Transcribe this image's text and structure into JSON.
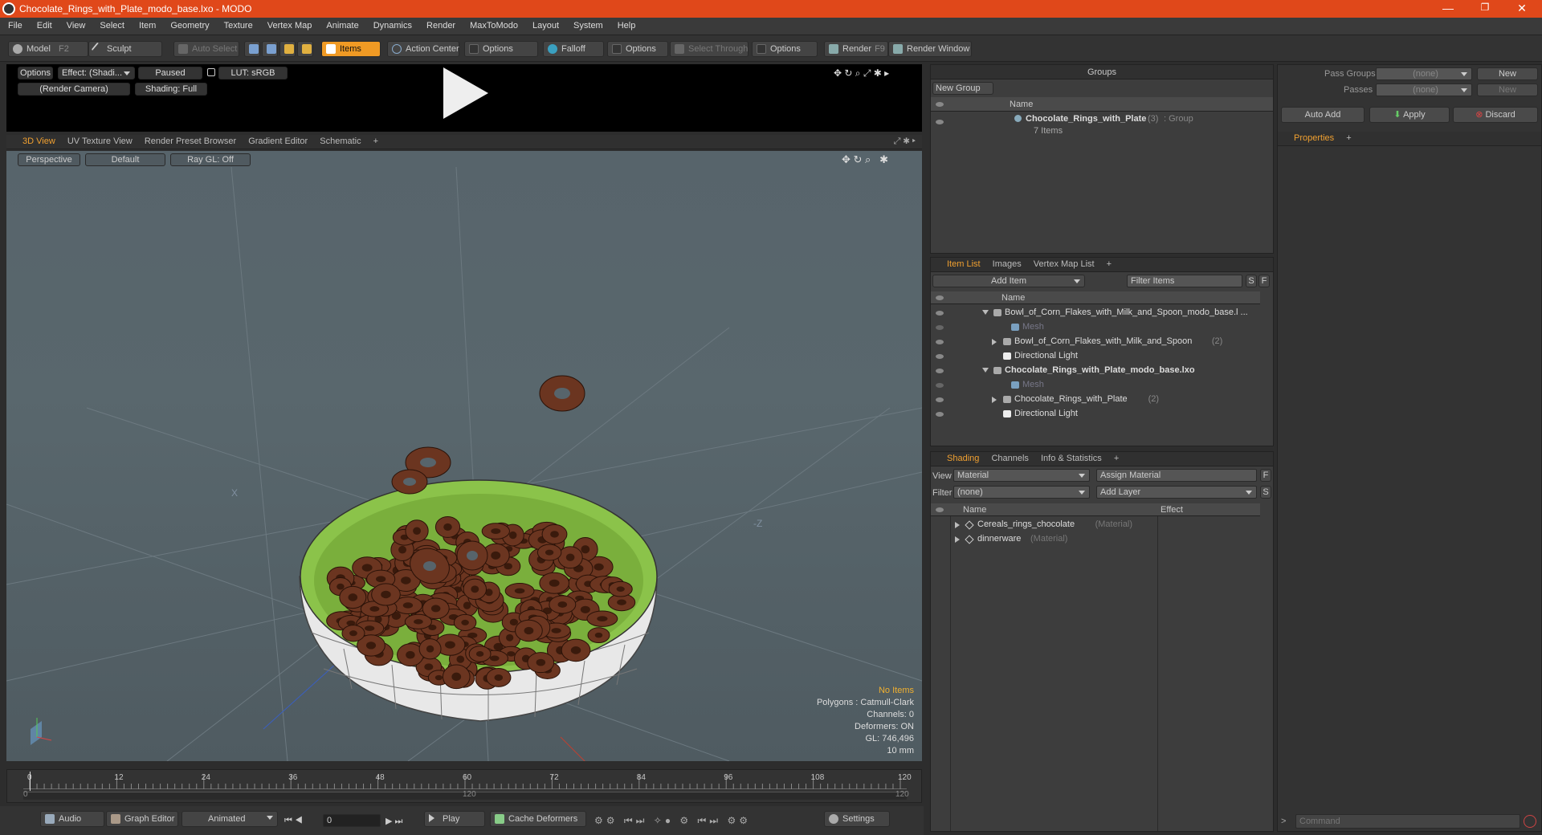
{
  "window": {
    "title": "Chocolate_Rings_with_Plate_modo_base.lxo - MODO",
    "minimize": "—",
    "maximize": "❐",
    "close": "✕"
  },
  "menu": [
    "File",
    "Edit",
    "View",
    "Select",
    "Item",
    "Geometry",
    "Texture",
    "Vertex Map",
    "Animate",
    "Dynamics",
    "Render",
    "MaxToModo",
    "Layout",
    "System",
    "Help"
  ],
  "toolbar": {
    "model": "Model",
    "model_key": "F2",
    "sculpt": "Sculpt",
    "auto_select": "Auto Select",
    "items": "Items",
    "action_center": "Action Center",
    "options1": "Options",
    "falloff": "Falloff",
    "options2": "Options",
    "select_through": "Select Through",
    "options3": "Options",
    "render": "Render",
    "render_key": "F9",
    "render_window": "Render Window"
  },
  "preview": {
    "options": "Options",
    "effect": "Effect: (Shadi...",
    "paused": "Paused",
    "lut": "LUT: sRGB",
    "camera": "(Render Camera)",
    "shading": "Shading: Full"
  },
  "viewport_tabs": [
    "3D View",
    "UV Texture View",
    "Render Preset Browser",
    "Gradient Editor",
    "Schematic",
    "+"
  ],
  "viewport_bar": {
    "perspective": "Perspective",
    "default": "Default",
    "raygl": "Ray GL: Off"
  },
  "viewport_stats": {
    "no_items": "No Items",
    "polygons": "Polygons : Catmull-Clark",
    "channels": "Channels: 0",
    "deformers": "Deformers: ON",
    "gl": "GL: 746,496",
    "size": "10 mm"
  },
  "timeline": {
    "ticks": [
      "0",
      "12",
      "24",
      "36",
      "48",
      "60",
      "72",
      "84",
      "96",
      "108",
      "120"
    ],
    "low": "0",
    "mid": "120",
    "high": "120"
  },
  "bottombar": {
    "audio": "Audio",
    "graph_editor": "Graph Editor",
    "animated": "Animated",
    "frame": "0",
    "play": "Play",
    "cache": "Cache Deformers",
    "settings": "Settings"
  },
  "groups": {
    "title": "Groups",
    "new_group": "New Group",
    "name_col": "Name",
    "item_name": "Chocolate_Rings_with_Plate",
    "item_count": "(3)",
    "item_type": ": Group",
    "item_sub": "7 Items"
  },
  "pass": {
    "pass_groups": "Pass Groups",
    "passes": "Passes",
    "none1": "(none)",
    "none2": "(none)",
    "new1": "New",
    "new2": "New",
    "auto_add": "Auto Add",
    "apply": "Apply",
    "discard": "Discard",
    "properties": "Properties",
    "plus": "+"
  },
  "itemlist": {
    "tabs": [
      "Item List",
      "Images",
      "Vertex Map List",
      "+"
    ],
    "add_item": "Add Item",
    "filter": "Filter Items",
    "s": "S",
    "f": "F",
    "name_col": "Name",
    "rows": [
      {
        "text": "Bowl_of_Corn_Flakes_with_Milk_and_Spoon_modo_base.l ...",
        "extra": "",
        "indent": 0,
        "bold": false,
        "kind": "scene"
      },
      {
        "text": "Mesh",
        "extra": "",
        "indent": 2,
        "bold": false,
        "kind": "mesh"
      },
      {
        "text": "Bowl_of_Corn_Flakes_with_Milk_and_Spoon",
        "extra": "(2)",
        "indent": 1,
        "bold": false,
        "kind": "group"
      },
      {
        "text": "Directional Light",
        "extra": "",
        "indent": 1,
        "bold": false,
        "kind": "light"
      },
      {
        "text": "Chocolate_Rings_with_Plate_modo_base.lxo",
        "extra": "",
        "indent": 0,
        "bold": true,
        "kind": "scene"
      },
      {
        "text": "Mesh",
        "extra": "",
        "indent": 2,
        "bold": false,
        "kind": "mesh"
      },
      {
        "text": "Chocolate_Rings_with_Plate",
        "extra": "(2)",
        "indent": 1,
        "bold": false,
        "kind": "group"
      },
      {
        "text": "Directional Light",
        "extra": "",
        "indent": 1,
        "bold": false,
        "kind": "light"
      }
    ]
  },
  "shading": {
    "tabs": [
      "Shading",
      "Channels",
      "Info & Statistics",
      "+"
    ],
    "view": "View",
    "material": "Material",
    "assign": "Assign Material",
    "f": "F",
    "filter": "Filter",
    "none": "(none)",
    "add_layer": "Add Layer",
    "s": "S",
    "name_col": "Name",
    "effect_col": "Effect",
    "rows": [
      {
        "name": "Cereals_rings_chocolate",
        "type": "(Material)"
      },
      {
        "name": "dinnerware",
        "type": "(Material)"
      }
    ]
  },
  "command": {
    "placeholder": "Command",
    "arrow": ">"
  }
}
